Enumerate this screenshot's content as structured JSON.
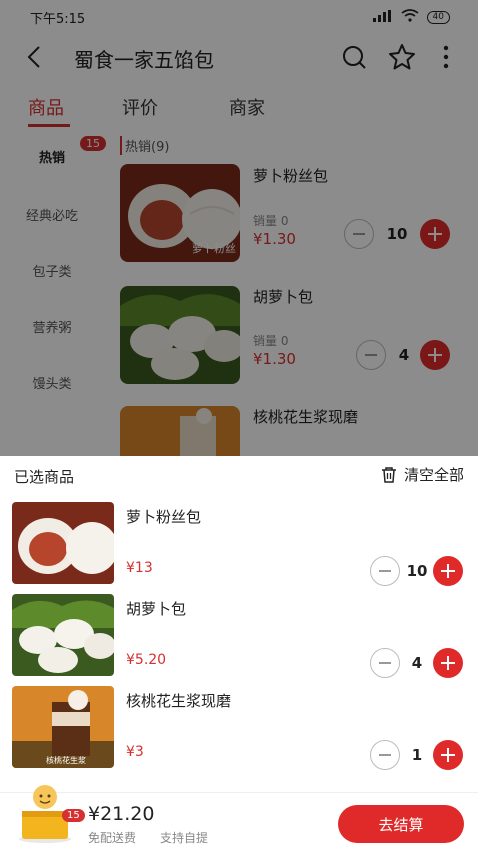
{
  "status_bar": {
    "time": "下午5:15",
    "signal": "HD",
    "battery": "40"
  },
  "header": {
    "title": "蜀食一家五馅包"
  },
  "tabs": [
    {
      "label": "商品"
    },
    {
      "label": "评价"
    },
    {
      "label": "商家"
    }
  ],
  "categories": [
    {
      "label": "热销",
      "badge": "15"
    },
    {
      "label": "经典必吃"
    },
    {
      "label": "包子类"
    },
    {
      "label": "营养粥"
    },
    {
      "label": "馒头类"
    }
  ],
  "section": {
    "heading": "热销(9)"
  },
  "products": [
    {
      "name": "萝卜粉丝包",
      "sales": "销量 0",
      "price": "¥1.30",
      "qty": "10"
    },
    {
      "name": "胡萝卜包",
      "sales": "销量 0",
      "price": "¥1.30",
      "qty": "4"
    },
    {
      "name": "核桃花生浆现磨"
    }
  ],
  "cart": {
    "title": "已选商品",
    "clear_label": "清空全部",
    "items": [
      {
        "name": "萝卜粉丝包",
        "price": "¥13",
        "qty": "10"
      },
      {
        "name": "胡萝卜包",
        "price": "¥5.20",
        "qty": "4"
      },
      {
        "name": "核桃花生浆现磨",
        "price": "¥3",
        "qty": "1"
      }
    ]
  },
  "bottom": {
    "badge": "15",
    "total": "¥21.20",
    "shipping": "免配送费",
    "pickup": "支持自提",
    "checkout_label": "去结算"
  },
  "image_text": {
    "product1_brand": "萝卜粉丝",
    "product3_brand": "核桃花生浆"
  },
  "colors": {
    "accent": "#e02a2a",
    "overlay": "rgba(0,0,0,0.45)"
  },
  "icons": [
    "back-arrow-icon",
    "search-icon",
    "star-icon",
    "more-vertical-icon",
    "trash-icon",
    "minus-icon",
    "plus-icon",
    "shopping-bag-icon"
  ]
}
